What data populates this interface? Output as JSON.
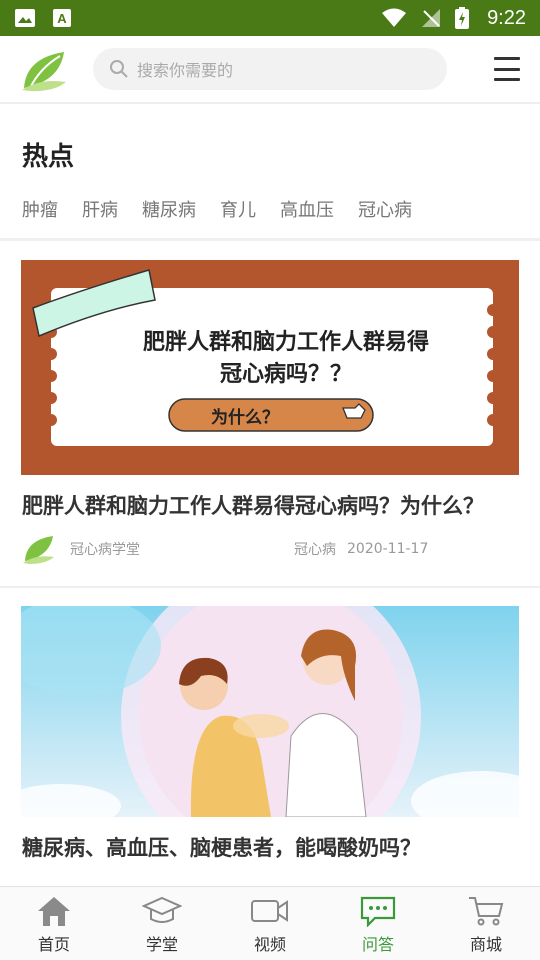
{
  "status_bar": {
    "time": "9:22"
  },
  "header": {
    "search_placeholder": "搜索你需要的"
  },
  "hot": {
    "title": "热点",
    "tags": [
      "肿瘤",
      "肝病",
      "糖尿病",
      "育儿",
      "高血压",
      "冠心病"
    ]
  },
  "articles": [
    {
      "banner_line1": "肥胖人群和脑力工作人群易得",
      "banner_line2": "冠心病吗？？",
      "banner_button": "为什么？",
      "title": "肥胖人群和脑力工作人群易得冠心病吗？为什么？",
      "source": "冠心病学堂",
      "tag": "冠心病",
      "date": "2020-11-17"
    },
    {
      "title": "糖尿病、高血压、脑梗患者，能喝酸奶吗？"
    }
  ],
  "bottom_nav": [
    {
      "label": "首页",
      "icon": "home-icon"
    },
    {
      "label": "学堂",
      "icon": "graduation-cap-icon"
    },
    {
      "label": "视频",
      "icon": "video-camera-icon"
    },
    {
      "label": "问答",
      "icon": "chat-icon",
      "active": true
    },
    {
      "label": "商城",
      "icon": "cart-icon"
    }
  ],
  "colors": {
    "status_bar": "#4a7a16",
    "accent_green": "#3a9a3a",
    "banner_brown": "#b3562d",
    "banner_button": "#d7864a"
  }
}
